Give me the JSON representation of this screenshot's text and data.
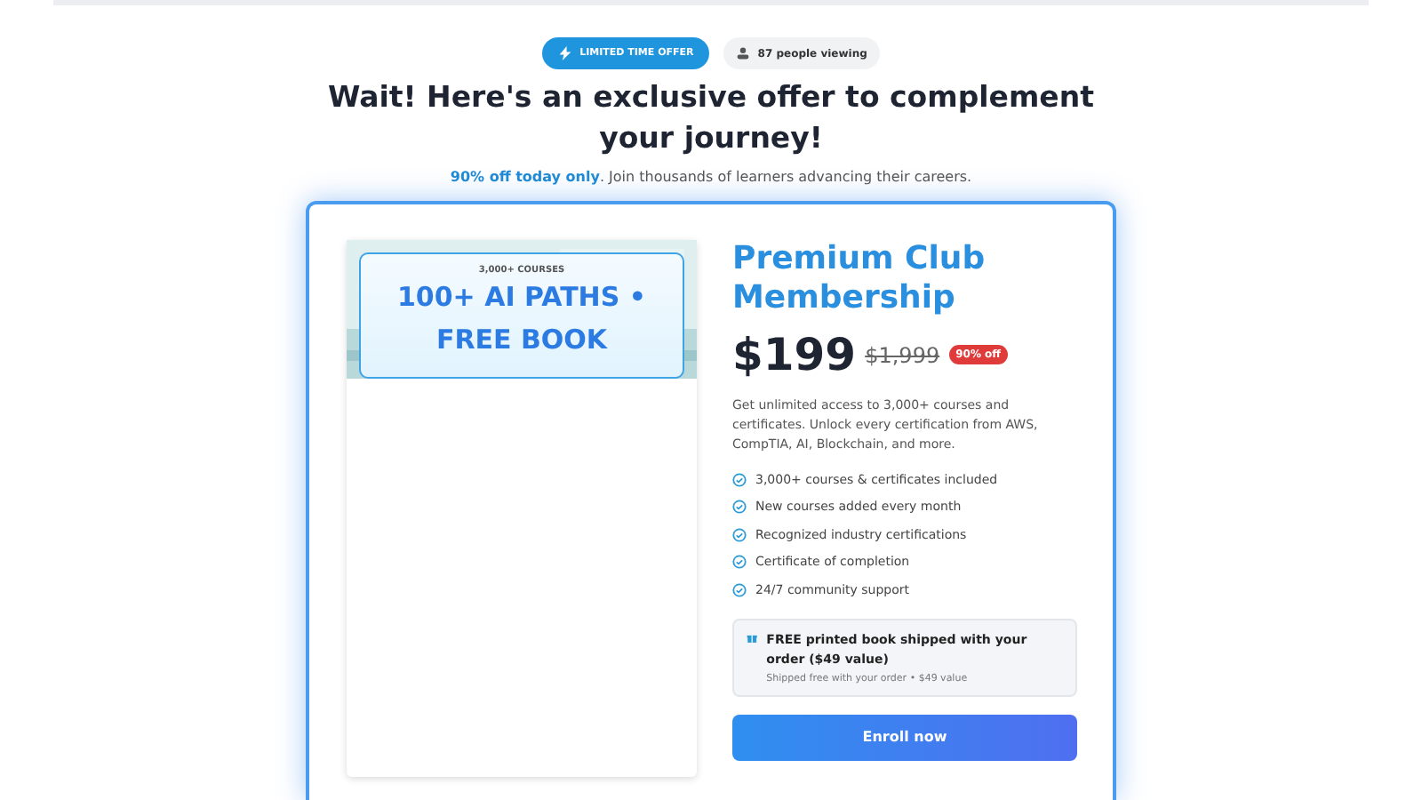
{
  "badges": {
    "offer": "LIMITED TIME OFFER",
    "viewers": "87 people viewing"
  },
  "heading": "Wait! Here's an exclusive offer to complement your journey!",
  "subheading": "**90% off today only**. Join thousands of learners advancing their careers.",
  "preview": {
    "eyebrow": "3,000+ COURSES",
    "title": "100+ AI PATHS • FREE BOOK"
  },
  "plan": {
    "title": "Premium Club Membership",
    "price": "$199",
    "old_price": "$1,999",
    "discount": "90% off",
    "description": "Get unlimited access to 3,000+ courses and certificates. Unlock every certification from AWS, CompTIA, AI, Blockchain, and more.",
    "features": [
      "3,000+ courses & certificates included",
      "New courses added every month",
      "Recognized industry certifications",
      "Certificate of completion",
      "24/7 community support"
    ],
    "bonus": {
      "title": "FREE printed book shipped with your order ($49 value)",
      "note": "Shipped free with your order • $49 value"
    },
    "button": "Enroll now"
  }
}
